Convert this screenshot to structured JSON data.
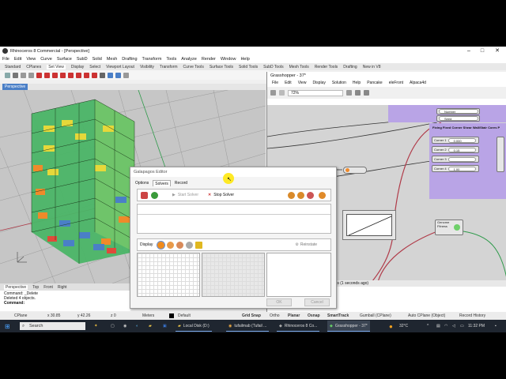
{
  "rhino": {
    "title": "Rhinoceros 8 Commercial - [Perspective]",
    "menu": [
      "File",
      "Edit",
      "View",
      "Curve",
      "Surface",
      "SubD",
      "Solid",
      "Mesh",
      "Drafting",
      "Transform",
      "Tools",
      "Analyze",
      "Render",
      "Window",
      "Help"
    ],
    "tabs": [
      "Standard",
      "CPlanes",
      "Set View",
      "Display",
      "Select",
      "Viewport Layout",
      "Visibility",
      "Transform",
      "Curve Tools",
      "Surface Tools",
      "Solid Tools",
      "SubD Tools",
      "Mesh Tools",
      "Render Tools",
      "Drafting",
      "New in V8"
    ],
    "active_tab": "Set View",
    "viewport_label": "Perspective",
    "viewport_tabs": [
      "Perspective",
      "Top",
      "Front",
      "Right"
    ],
    "command_lines": [
      "Command: _Delete",
      "Deleted 4 objects."
    ],
    "command_prompt": "Command:",
    "status": {
      "cplane": "CPlane",
      "x": "x 30.85",
      "y": "y 42.26",
      "z": "z 0",
      "units": "Meters",
      "layer": "Default",
      "toggles": [
        "Grid Snap",
        "Ortho",
        "Planar",
        "Osnap",
        "SmartTrack",
        "Gumball (CPlane)",
        "Auto CPlane (Object)",
        "Record History"
      ]
    }
  },
  "grasshopper": {
    "title": "Grasshopper - 37*",
    "menu": [
      "File",
      "Edit",
      "View",
      "Display",
      "Solution",
      "Help",
      "Pancake",
      "eleFront",
      "Alpaca4d"
    ],
    "zoom": "72%",
    "group_title": "Fixing Fixed Corner Shear Wall/Stair Cores P",
    "sliders": [
      {
        "label": "Corner 1",
        "value": "0.000"
      },
      {
        "label": "Corner 2",
        "value": "0.15"
      },
      {
        "label": "Corner 3",
        "value": ""
      },
      {
        "label": "Corner 4",
        "value": "1.00"
      }
    ],
    "top_nodes": [
      "Number",
      "Seed"
    ],
    "genome_label": "Genome",
    "fitness_label": "Fitness",
    "status_text": "onds (1 seconds ago)"
  },
  "galapagos": {
    "title": "Galapagos Editor",
    "tabs": [
      "Options",
      "Solvers",
      "Record"
    ],
    "active_tab": "Solvers",
    "start_solver": "Start Solver",
    "stop_solver": "Stop Solver",
    "display_label": "Display",
    "reinstate": "Reinstate",
    "ok": "OK",
    "cancel": "Cancel"
  },
  "taskbar": {
    "search": "Search",
    "items": [
      "Local Disk (D:)",
      "tufailmab (Tufail ...",
      "Rhinoceros 8 Co...",
      "Grasshopper - 37*"
    ],
    "weather": "32°C",
    "time": "11:32 PM"
  },
  "colors": {
    "accent": "#4a7fc7",
    "purple_group": "#b9a4e6",
    "wire_red": "#b03a48",
    "wire_green": "#2e9a4a"
  }
}
